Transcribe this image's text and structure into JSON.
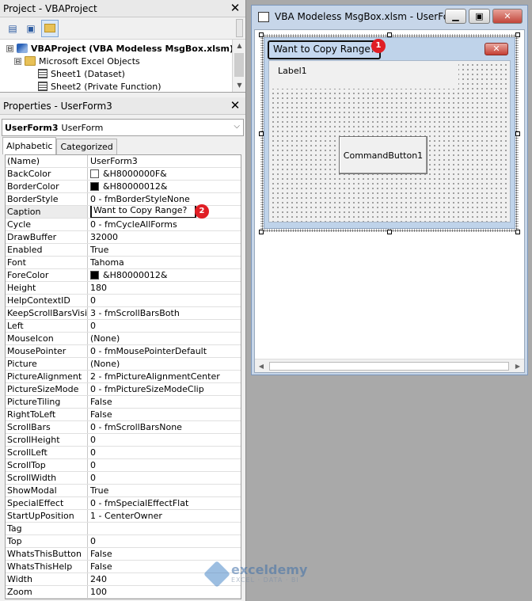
{
  "project_pane": {
    "title": "Project - VBAProject",
    "tree": [
      {
        "expander": "⊟",
        "label": "VBAProject (VBA Modeless MsgBox.xlsm)",
        "bold": true
      },
      {
        "expander": "⊟",
        "label": "Microsoft Excel Objects",
        "bold": false
      },
      {
        "label": "Sheet1 (Dataset)"
      },
      {
        "label": "Sheet2 (Private Function)"
      }
    ]
  },
  "properties_pane": {
    "title": "Properties - UserForm3",
    "object_name": "UserForm3",
    "object_type": "UserForm",
    "tabs": [
      "Alphabetic",
      "Categorized"
    ],
    "rows": [
      {
        "name": "(Name)",
        "value": "UserForm3"
      },
      {
        "name": "BackColor",
        "value": "&H8000000F&",
        "swatch": "#ffffff"
      },
      {
        "name": "BorderColor",
        "value": "&H80000012&",
        "swatch": "#000000"
      },
      {
        "name": "BorderStyle",
        "value": "0 - fmBorderStyleNone"
      },
      {
        "name": "Caption",
        "value": "Want to Copy Range?"
      },
      {
        "name": "Cycle",
        "value": "0 - fmCycleAllForms"
      },
      {
        "name": "DrawBuffer",
        "value": "32000"
      },
      {
        "name": "Enabled",
        "value": "True"
      },
      {
        "name": "Font",
        "value": "Tahoma"
      },
      {
        "name": "ForeColor",
        "value": "&H80000012&",
        "swatch": "#000000"
      },
      {
        "name": "Height",
        "value": "180"
      },
      {
        "name": "HelpContextID",
        "value": "0"
      },
      {
        "name": "KeepScrollBarsVisible",
        "value": "3 - fmScrollBarsBoth"
      },
      {
        "name": "Left",
        "value": "0"
      },
      {
        "name": "MouseIcon",
        "value": "(None)"
      },
      {
        "name": "MousePointer",
        "value": "0 - fmMousePointerDefault"
      },
      {
        "name": "Picture",
        "value": "(None)"
      },
      {
        "name": "PictureAlignment",
        "value": "2 - fmPictureAlignmentCenter"
      },
      {
        "name": "PictureSizeMode",
        "value": "0 - fmPictureSizeModeClip"
      },
      {
        "name": "PictureTiling",
        "value": "False"
      },
      {
        "name": "RightToLeft",
        "value": "False"
      },
      {
        "name": "ScrollBars",
        "value": "0 - fmScrollBarsNone"
      },
      {
        "name": "ScrollHeight",
        "value": "0"
      },
      {
        "name": "ScrollLeft",
        "value": "0"
      },
      {
        "name": "ScrollTop",
        "value": "0"
      },
      {
        "name": "ScrollWidth",
        "value": "0"
      },
      {
        "name": "ShowModal",
        "value": "True"
      },
      {
        "name": "SpecialEffect",
        "value": "0 - fmSpecialEffectFlat"
      },
      {
        "name": "StartUpPosition",
        "value": "1 - CenterOwner"
      },
      {
        "name": "Tag",
        "value": ""
      },
      {
        "name": "Top",
        "value": "0"
      },
      {
        "name": "WhatsThisButton",
        "value": "False"
      },
      {
        "name": "WhatsThisHelp",
        "value": "False"
      },
      {
        "name": "Width",
        "value": "240"
      },
      {
        "name": "Zoom",
        "value": "100"
      }
    ]
  },
  "designer": {
    "window_title": "VBA Modeless MsgBox.xlsm - UserFor...",
    "form_caption": "Want to Copy Range?",
    "label_text": "Label1",
    "button_text": "CommandButton1"
  },
  "badges": {
    "one": "1",
    "two": "2"
  },
  "watermark": {
    "name": "exceldemy",
    "tagline": "EXCEL · DATA · BI"
  },
  "colors": {
    "badge": "#e01e25",
    "form_bg": "#bfd3ea",
    "designer_bg": "#c7d6e9"
  }
}
